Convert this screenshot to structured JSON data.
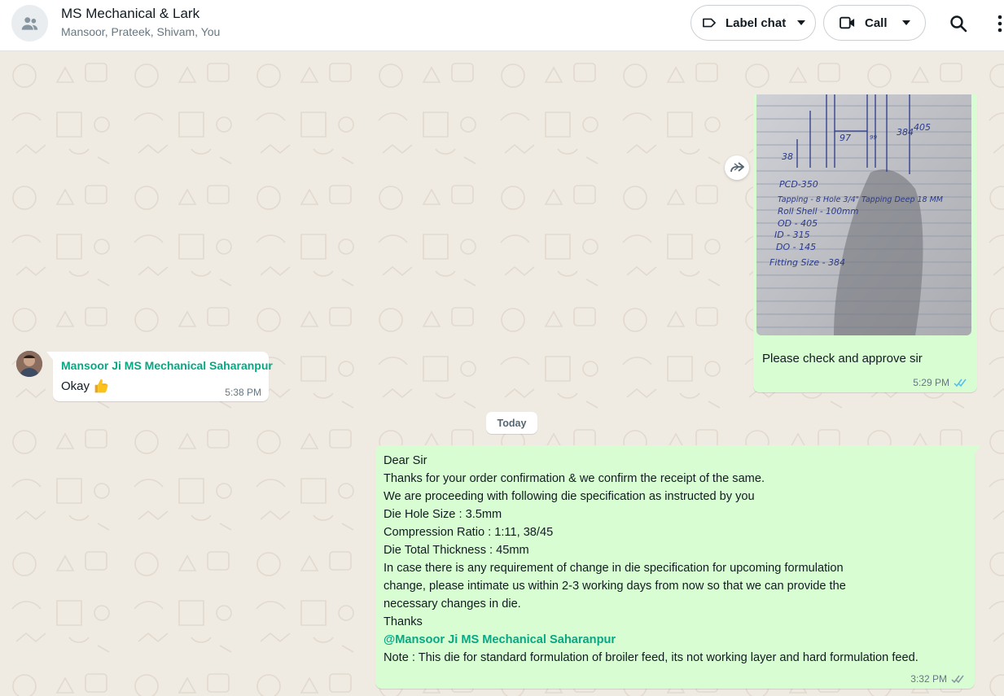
{
  "header": {
    "title": "MS Mechanical & Lark",
    "members": "Mansoor, Prateek, Shivam, You",
    "label_chat": "Label chat",
    "call": "Call",
    "icons": [
      "group-icon",
      "label-icon",
      "video-icon",
      "chevron-down-icon",
      "search-icon",
      "more-vertical-icon"
    ]
  },
  "image_message": {
    "caption": "Please check and approve sir",
    "time": "5:29 PM",
    "status": "read",
    "note_lines": [
      "PCD-350",
      "Tapping - 8 Hole 3/4\" Tapping Deep 18 MM",
      "Roll Shell - 100mm",
      "OD - 405",
      "ID - 315",
      "DO - 145",
      "Fitting Size - 384"
    ],
    "dims": [
      "38",
      "97",
      "384",
      "405",
      "99"
    ]
  },
  "incoming_message": {
    "sender": "Mansoor Ji MS Mechanical Saharanpur",
    "text": "Okay",
    "emoji": "thumbs-up-icon",
    "time": "5:38 PM"
  },
  "date_separator": "Today",
  "outgoing_message": {
    "lines": [
      "Dear Sir",
      "Thanks for your order confirmation & we confirm the receipt of the same.",
      "We are proceeding with following die specification as instructed by you",
      "Die Hole Size : 3.5mm",
      "Compression Ratio : 1:11, 38/45",
      "Die Total Thickness : 45mm",
      "In case there is any requirement of change in die specification for upcoming formulation",
      "change, please intimate us within 2-3 working days from now so that we can provide the",
      "necessary changes in die.",
      "Thanks"
    ],
    "mention": "@Mansoor Ji MS Mechanical Saharanpur",
    "note": "Note : This die for standard formulation of broiler feed, its not working layer and hard formulation feed.",
    "time": "3:32 PM",
    "status": "delivered"
  },
  "colors": {
    "outgoing_bubble": "#d9fdd3",
    "incoming_bubble": "#ffffff",
    "chat_background": "#efeae2",
    "sender_name": "#06a884",
    "read_ticks": "#53bdeb",
    "delivered_ticks": "#8696a0"
  }
}
